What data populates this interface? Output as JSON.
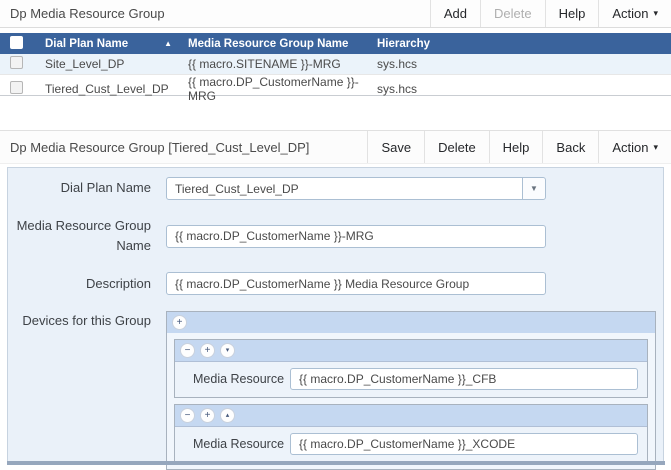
{
  "icons": {
    "sort_ascending": "▲",
    "caret_down": "▾",
    "select_arrow": "▼",
    "add": "+",
    "remove": "−",
    "move_down": "▾",
    "move_up": "▴"
  },
  "colors": {
    "table_header_blue": "#3A639C",
    "row_highlight_blue": "#EBF3FA",
    "form_background_blue": "#EAF1F9",
    "group_header_blue": "#C5D8F1"
  },
  "list_panel": {
    "title": "Dp Media Resource Group",
    "toolbar": {
      "add": "Add",
      "delete": "Delete",
      "help": "Help",
      "action": "Action"
    },
    "table": {
      "columns": {
        "dial_plan_name": "Dial Plan Name",
        "mrg_name": "Media Resource Group Name",
        "hierarchy": "Hierarchy"
      },
      "sorted_by": "Dial Plan Name ascending",
      "rows": [
        {
          "dial_plan_name": "Site_Level_DP",
          "mrg_name": "{{ macro.SITENAME }}-MRG",
          "hierarchy": "sys.hcs",
          "checked": false
        },
        {
          "dial_plan_name": "Tiered_Cust_Level_DP",
          "mrg_name": "{{ macro.DP_CustomerName }}-MRG",
          "hierarchy": "sys.hcs",
          "checked": false
        }
      ]
    }
  },
  "detail_panel": {
    "title": "Dp Media Resource Group [Tiered_Cust_Level_DP]",
    "toolbar": {
      "save": "Save",
      "delete": "Delete",
      "help": "Help",
      "back": "Back",
      "action": "Action"
    },
    "fields": {
      "dial_plan_name": {
        "label": "Dial Plan Name",
        "value": "Tiered_Cust_Level_DP"
      },
      "mrg_name": {
        "label": "Media Resource Group Name",
        "value": "{{ macro.DP_CustomerName }}-MRG"
      },
      "description": {
        "label": "Description",
        "value": "{{ macro.DP_CustomerName }} Media Resource Group"
      },
      "devices_group": {
        "label": "Devices for this Group",
        "items": [
          {
            "field_label": "Media Resource",
            "value": "{{ macro.DP_CustomerName }}_CFB"
          },
          {
            "field_label": "Media Resource",
            "value": "{{ macro.DP_CustomerName }}_XCODE"
          }
        ]
      }
    }
  }
}
